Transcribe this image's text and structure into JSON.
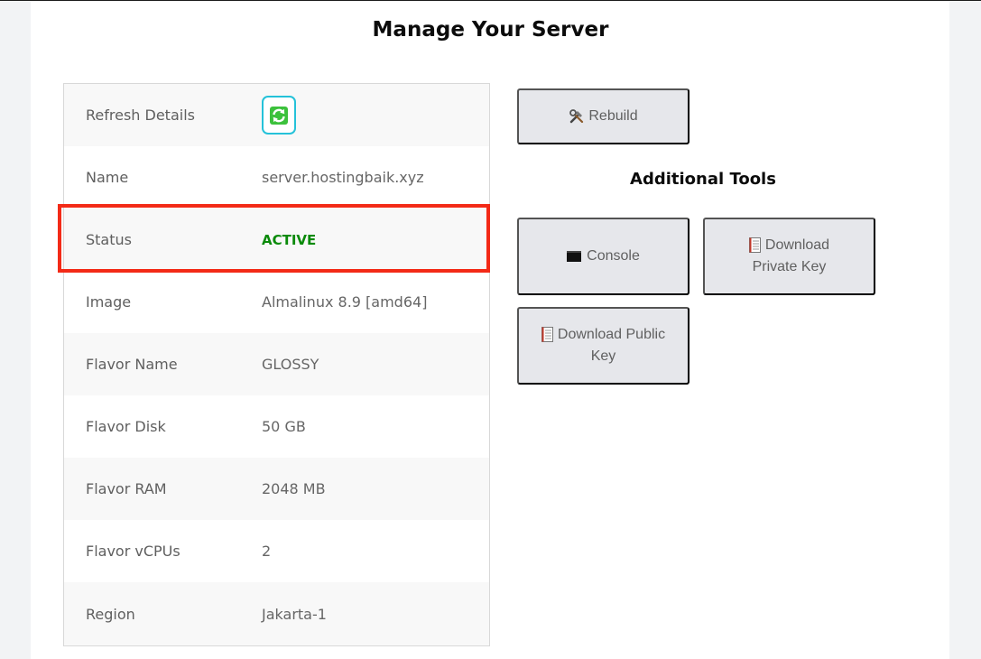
{
  "page": {
    "title": "Manage Your Server"
  },
  "details": {
    "rows": [
      {
        "label": "Refresh Details",
        "value": ""
      },
      {
        "label": "Name",
        "value": "server.hostingbaik.xyz"
      },
      {
        "label": "Status",
        "value": "ACTIVE"
      },
      {
        "label": "Image",
        "value": "Almalinux 8.9 [amd64]"
      },
      {
        "label": "Flavor Name",
        "value": "GLOSSY"
      },
      {
        "label": "Flavor Disk",
        "value": "50 GB"
      },
      {
        "label": "Flavor RAM",
        "value": "2048 MB"
      },
      {
        "label": "Flavor vCPUs",
        "value": "2"
      },
      {
        "label": "Region",
        "value": "Jakarta-1"
      }
    ]
  },
  "actions": {
    "rebuild_label": "Rebuild",
    "tools_title": "Additional Tools",
    "console_label": "Console",
    "download_private_key_line1": "Download",
    "download_private_key_line2": "Private Key",
    "download_public_key_line1": "Download Public",
    "download_public_key_line2": "Key"
  },
  "icons": {
    "refresh": "refresh-icon",
    "rebuild": "tools-icon",
    "console": "terminal-icon",
    "download": "document-icon"
  },
  "colors": {
    "status_active": "#0a8a0a",
    "highlight_border": "#f32a17",
    "refresh_border": "#25c2d9",
    "refresh_arrows": "#3cc13c",
    "button_bg": "#e6e7eb"
  }
}
